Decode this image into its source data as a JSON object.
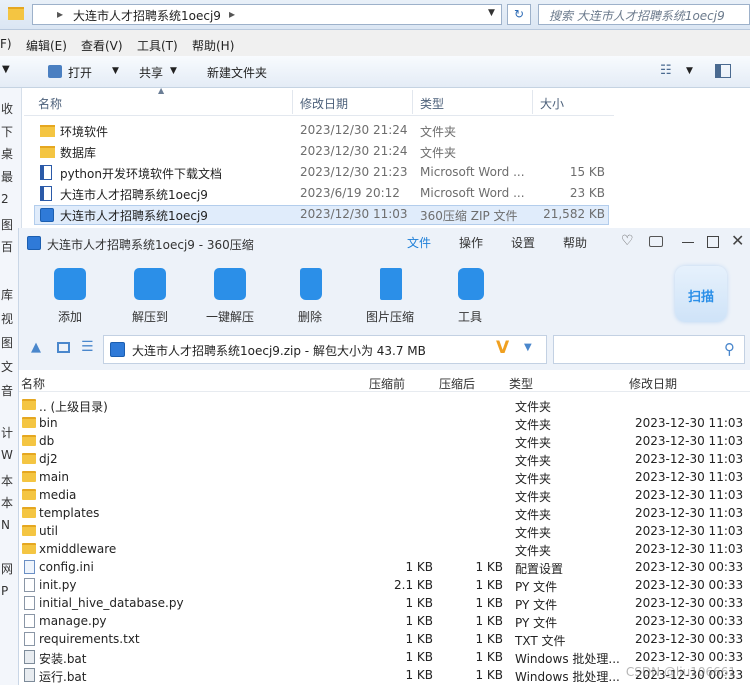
{
  "explorer": {
    "breadcrumb": "大连市人才招聘系统1oecj9",
    "search_placeholder": "搜索 大连市人才招聘系统1oecj9",
    "menu": [
      "F)",
      "编辑(E)",
      "查看(V)",
      "工具(T)",
      "帮助(H)"
    ],
    "toolbar": {
      "open": "打开",
      "share": "共享",
      "new_folder": "新建文件夹"
    },
    "columns": {
      "name": "名称",
      "date": "修改日期",
      "type": "类型",
      "size": "大小"
    },
    "rows": [
      {
        "name": "环境软件",
        "date": "2023/12/30 21:24",
        "type": "文件夹",
        "size": "",
        "icon": "folder-icon"
      },
      {
        "name": "数据库",
        "date": "2023/12/30 21:24",
        "type": "文件夹",
        "size": "",
        "icon": "folder-icon"
      },
      {
        "name": "python开发环境软件下载文档",
        "date": "2023/12/30 21:23",
        "type": "Microsoft Word ...",
        "size": "15 KB",
        "icon": "word-doc-icon"
      },
      {
        "name": "大连市人才招聘系统1oecj9",
        "date": "2023/6/19 20:12",
        "type": "Microsoft Word ...",
        "size": "23 KB",
        "icon": "word-doc-icon"
      },
      {
        "name": "大连市人才招聘系统1oecj9",
        "date": "2023/12/30 11:03",
        "type": "360压缩 ZIP 文件",
        "size": "21,582 KB",
        "icon": "zip-icon"
      }
    ],
    "sidebar_fragments": [
      "收",
      "下",
      "桌",
      "最",
      "2",
      "图",
      "百",
      "库",
      "视",
      "图",
      "文",
      "音",
      "计",
      "W",
      "本",
      "本",
      "N",
      "网",
      "P"
    ]
  },
  "zip": {
    "title": "大连市人才招聘系统1oecj9 - 360压缩",
    "menu": [
      "文件",
      "操作",
      "设置",
      "帮助"
    ],
    "tools": [
      "添加",
      "解压到",
      "一键解压",
      "删除",
      "图片压缩",
      "工具"
    ],
    "scan": "扫描",
    "path": "大连市人才招聘系统1oecj9.zip - 解包大小为 43.7 MB",
    "columns": {
      "name": "名称",
      "compressed_before": "压缩前",
      "compressed_after": "压缩后",
      "type": "类型",
      "date": "修改日期"
    },
    "rows": [
      {
        "name": ".. (上级目录)",
        "before": "",
        "after": "",
        "type": "文件夹",
        "date": "",
        "kind": "folder"
      },
      {
        "name": "bin",
        "before": "",
        "after": "",
        "type": "文件夹",
        "date": "2023-12-30 11:03",
        "kind": "folder"
      },
      {
        "name": "db",
        "before": "",
        "after": "",
        "type": "文件夹",
        "date": "2023-12-30 11:03",
        "kind": "folder"
      },
      {
        "name": "dj2",
        "before": "",
        "after": "",
        "type": "文件夹",
        "date": "2023-12-30 11:03",
        "kind": "folder"
      },
      {
        "name": "main",
        "before": "",
        "after": "",
        "type": "文件夹",
        "date": "2023-12-30 11:03",
        "kind": "folder"
      },
      {
        "name": "media",
        "before": "",
        "after": "",
        "type": "文件夹",
        "date": "2023-12-30 11:03",
        "kind": "folder"
      },
      {
        "name": "templates",
        "before": "",
        "after": "",
        "type": "文件夹",
        "date": "2023-12-30 11:03",
        "kind": "folder"
      },
      {
        "name": "util",
        "before": "",
        "after": "",
        "type": "文件夹",
        "date": "2023-12-30 11:03",
        "kind": "folder"
      },
      {
        "name": "xmiddleware",
        "before": "",
        "after": "",
        "type": "文件夹",
        "date": "2023-12-30 11:03",
        "kind": "folder"
      },
      {
        "name": "config.ini",
        "before": "1 KB",
        "after": "1 KB",
        "type": "配置设置",
        "date": "2023-12-30 00:33",
        "kind": "config"
      },
      {
        "name": "init.py",
        "before": "2.1 KB",
        "after": "1 KB",
        "type": "PY 文件",
        "date": "2023-12-30 00:33",
        "kind": "file"
      },
      {
        "name": "initial_hive_database.py",
        "before": "1 KB",
        "after": "1 KB",
        "type": "PY 文件",
        "date": "2023-12-30 00:33",
        "kind": "file"
      },
      {
        "name": "manage.py",
        "before": "1 KB",
        "after": "1 KB",
        "type": "PY 文件",
        "date": "2023-12-30 00:33",
        "kind": "file"
      },
      {
        "name": "requirements.txt",
        "before": "1 KB",
        "after": "1 KB",
        "type": "TXT 文件",
        "date": "2023-12-30 00:33",
        "kind": "file"
      },
      {
        "name": "安装.bat",
        "before": "1 KB",
        "after": "1 KB",
        "type": "Windows 批处理...",
        "date": "2023-12-30 00:33",
        "kind": "bat"
      },
      {
        "name": "运行.bat",
        "before": "1 KB",
        "after": "1 KB",
        "type": "Windows 批处理...",
        "date": "2023-12-30 00:33",
        "kind": "bat"
      }
    ]
  },
  "watermark": "CSDN @liu106661",
  "colors": {
    "accent": "#1e7fd8",
    "folder": "#f4c542",
    "selection": "#e0ecfb"
  }
}
